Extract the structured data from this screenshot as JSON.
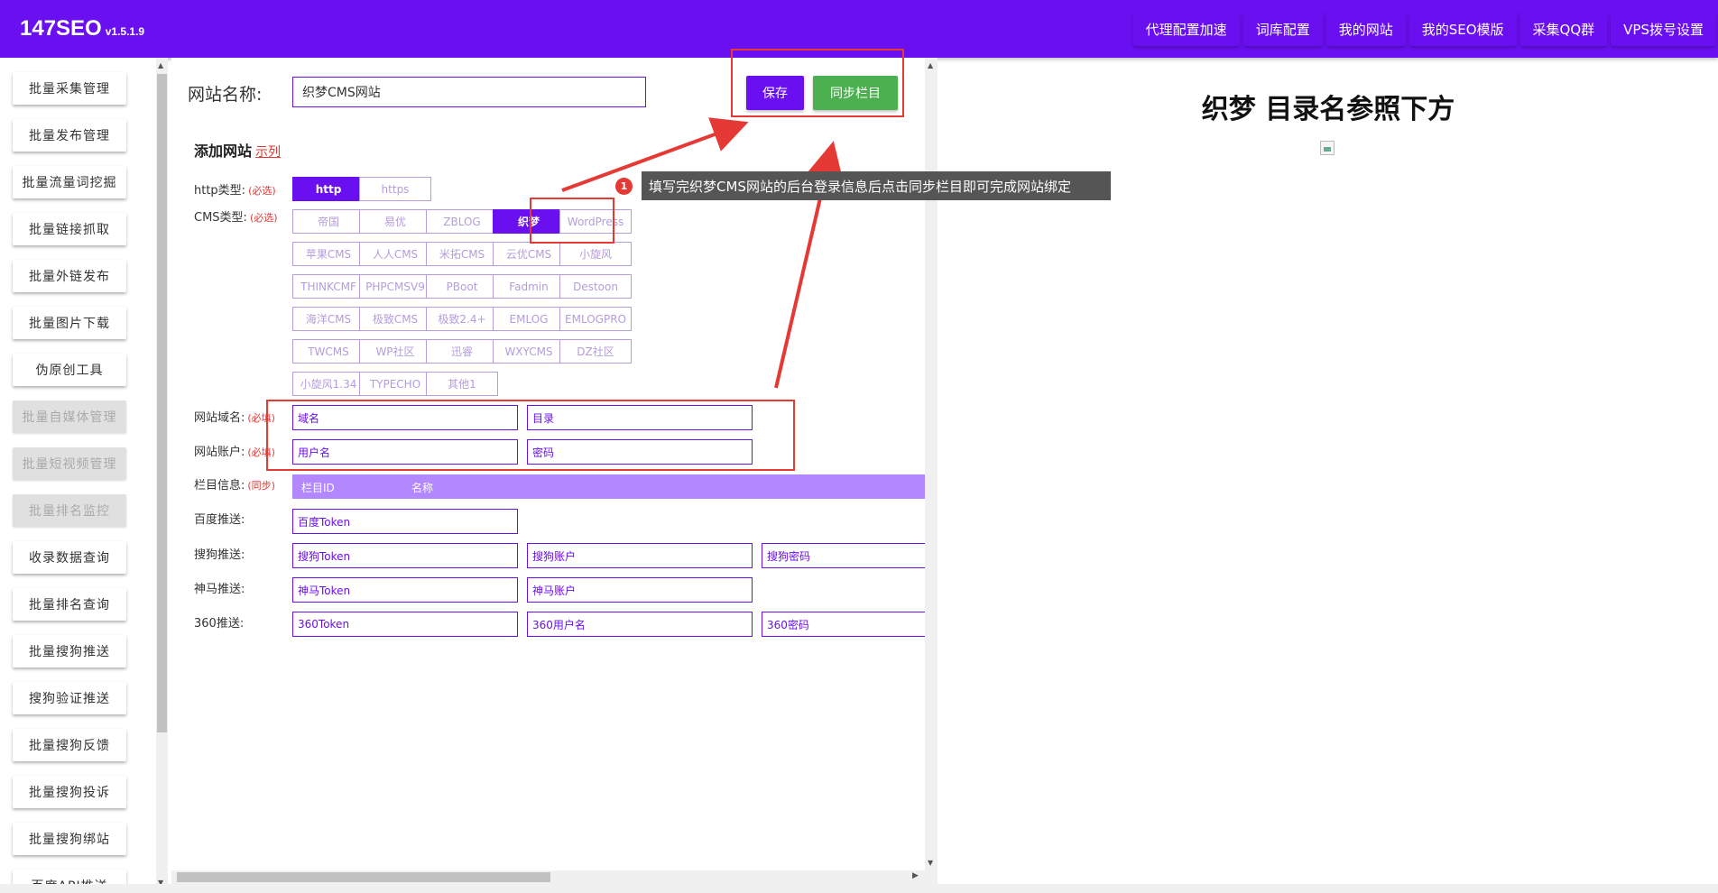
{
  "header": {
    "brand": "147SEO",
    "version": "v1.5.1.9",
    "nav": [
      "代理配置加速",
      "词库配置",
      "我的网站",
      "我的SEO模版",
      "采集QQ群",
      "VPS拨号设置"
    ]
  },
  "sidebar": {
    "items": [
      {
        "label": "批量采集管理",
        "enabled": true
      },
      {
        "label": "批量发布管理",
        "enabled": true
      },
      {
        "label": "批量流量词挖掘",
        "enabled": true
      },
      {
        "label": "批量链接抓取",
        "enabled": true
      },
      {
        "label": "批量外链发布",
        "enabled": true
      },
      {
        "label": "批量图片下载",
        "enabled": true
      },
      {
        "label": "伪原创工具",
        "enabled": true
      },
      {
        "label": "批量自媒体管理",
        "enabled": false
      },
      {
        "label": "批量短视频管理",
        "enabled": false
      },
      {
        "label": "批量排名监控",
        "enabled": false
      },
      {
        "label": "收录数据查询",
        "enabled": true
      },
      {
        "label": "批量排名查询",
        "enabled": true
      },
      {
        "label": "批量搜狗推送",
        "enabled": true
      },
      {
        "label": "搜狗验证推送",
        "enabled": true
      },
      {
        "label": "批量搜狗反馈",
        "enabled": true
      },
      {
        "label": "批量搜狗投诉",
        "enabled": true
      },
      {
        "label": "批量搜狗绑站",
        "enabled": true
      },
      {
        "label": "百度API推送",
        "enabled": true
      }
    ]
  },
  "form": {
    "site_name_label": "网站名称:",
    "site_name_value": "织梦CMS网站",
    "save_label": "保存",
    "sync_label": "同步栏目",
    "section_title": "添加网站",
    "example_link": "示列",
    "required_mark": "(必选)",
    "required_fill": "(必填)",
    "sync_mark": "(同步)",
    "http_label": "http类型:",
    "http_options": [
      "http",
      "https"
    ],
    "http_selected": "http",
    "cms_label": "CMS类型:",
    "cms_options": [
      "帝国",
      "易优",
      "ZBLOG",
      "织梦",
      "WordPress",
      "苹果CMS",
      "人人CMS",
      "米拓CMS",
      "云优CMS",
      "小旋风",
      "THINKCMF",
      "PHPCMSV9",
      "PBoot",
      "Fadmin",
      "Destoon",
      "海洋CMS",
      "极致CMS",
      "极致2.4+",
      "EMLOG",
      "EMLOGPRO",
      "TWCMS",
      "WP社区",
      "迅睿",
      "WXYCMS",
      "DZ社区",
      "小旋风1.34",
      "TYPECHO",
      "其他1"
    ],
    "cms_selected": "织梦",
    "domain_label": "网站域名:",
    "domain_placeholder": "域名",
    "dir_placeholder": "目录",
    "account_label": "网站账户:",
    "username_placeholder": "用户名",
    "password_placeholder": "密码",
    "column_label": "栏目信息:",
    "column_headers": [
      "栏目ID",
      "名称"
    ],
    "baidu_label": "百度推送:",
    "baidu_token": "百度Token",
    "sogou_label": "搜狗推送:",
    "sogou_token": "搜狗Token",
    "sogou_account": "搜狗账户",
    "sogou_password": "搜狗密码",
    "shenma_label": "神马推送:",
    "shenma_token": "神马Token",
    "shenma_account": "神马账户",
    "s360_label": "360推送:",
    "s360_token": "360Token",
    "s360_user": "360用户名",
    "s360_password": "360密码"
  },
  "right_panel": {
    "title": "织梦 目录名参照下方"
  },
  "annotation": {
    "number": "1",
    "text": "填写完织梦CMS网站的后台登录信息后点击同步栏目即可完成网站绑定"
  },
  "colors": {
    "primary": "#6a0ff0",
    "success": "#4caf50",
    "header_row": "#b388ff",
    "annotation_red": "#e53935"
  }
}
